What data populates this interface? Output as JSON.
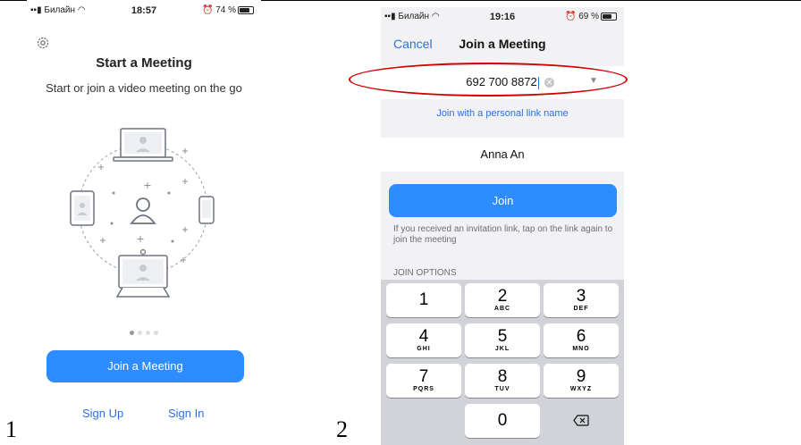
{
  "labels": {
    "first": "1",
    "second": "2"
  },
  "screen1": {
    "status": {
      "carrier": "Билайн",
      "time": "18:57",
      "battery": "74 %"
    },
    "title": "Start a Meeting",
    "subtitle": "Start or join a video meeting on the go",
    "join_button": "Join a Meeting",
    "sign_up": "Sign Up",
    "sign_in": "Sign In",
    "page_dots": {
      "count": 4,
      "active": 0
    }
  },
  "screen2": {
    "status": {
      "carrier": "Билайн",
      "time": "19:16",
      "battery": "69 %"
    },
    "cancel": "Cancel",
    "title": "Join a Meeting",
    "meeting_id": "692 700 8872",
    "personal_link": "Join with a personal link name",
    "display_name": "Anna An",
    "join_button": "Join",
    "hint": "If you received an invitation link, tap on the link again to join the meeting",
    "options_header": "JOIN OPTIONS",
    "keypad": [
      {
        "digit": "1",
        "letters": ""
      },
      {
        "digit": "2",
        "letters": "ABC"
      },
      {
        "digit": "3",
        "letters": "DEF"
      },
      {
        "digit": "4",
        "letters": "GHI"
      },
      {
        "digit": "5",
        "letters": "JKL"
      },
      {
        "digit": "6",
        "letters": "MNO"
      },
      {
        "digit": "7",
        "letters": "PQRS"
      },
      {
        "digit": "8",
        "letters": "TUV"
      },
      {
        "digit": "9",
        "letters": "WXYZ"
      },
      {
        "digit": "0",
        "letters": ""
      }
    ]
  },
  "colors": {
    "accent": "#2d8cff",
    "link": "#2d70d8",
    "highlight": "#d00000"
  }
}
